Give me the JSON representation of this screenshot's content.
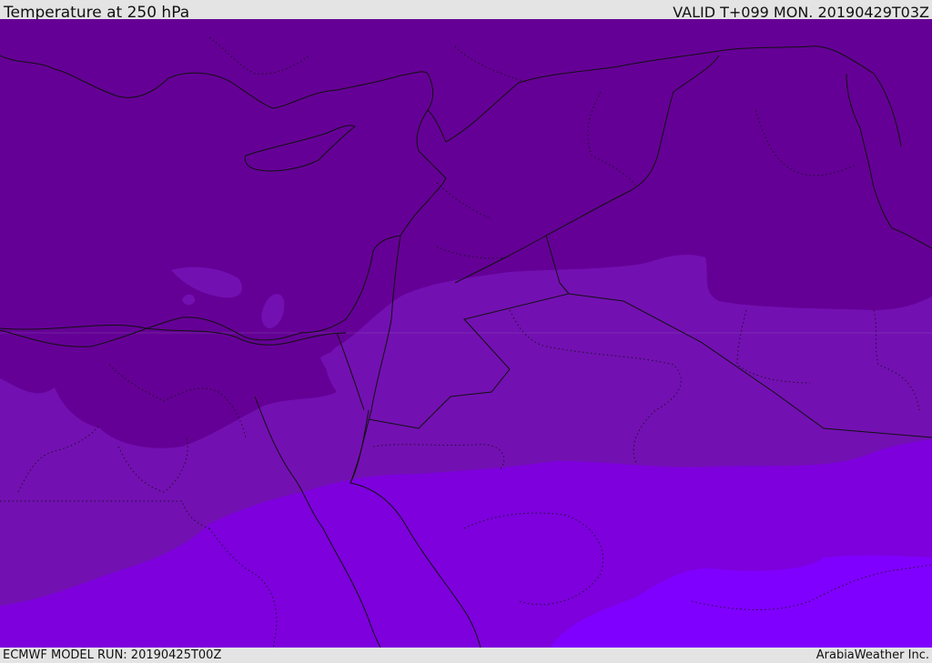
{
  "header": {
    "title": "Temperature at 250 hPa",
    "valid": "VALID T+099 MON. 20190429T03Z"
  },
  "footer": {
    "model_run": "ECMWF MODEL RUN: 20190425T00Z",
    "credit": "ArabiaWeather Inc."
  },
  "map": {
    "field": "temperature",
    "level": "250 hPa",
    "palette": {
      "band_coldest": "#650096",
      "band_cold": "#7310b2",
      "band_mid": "#7d00dd",
      "band_warm": "#8000ff",
      "land_lines": "#111111"
    }
  }
}
